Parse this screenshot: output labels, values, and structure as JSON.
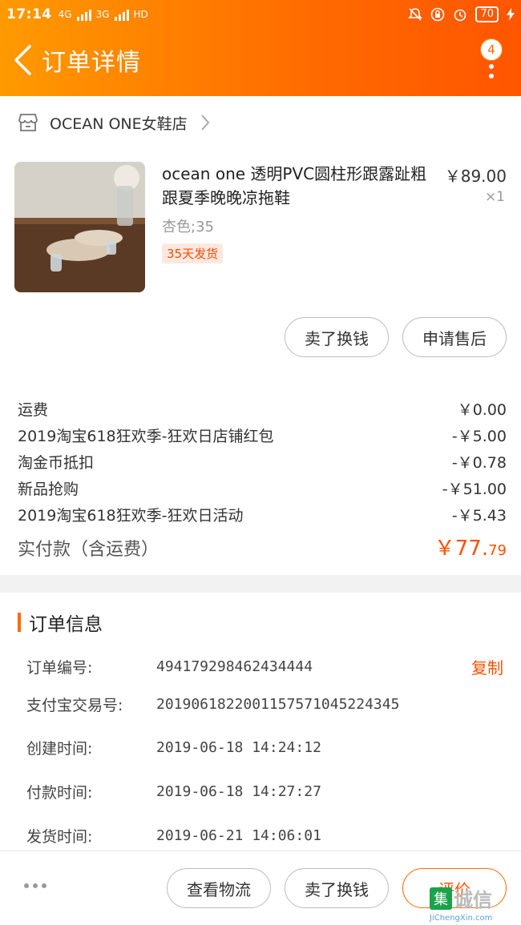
{
  "status_bar": {
    "time": "17:14",
    "net1": "4G",
    "net2": "3G",
    "net3": "HD",
    "battery": "70"
  },
  "nav": {
    "title": "订单详情",
    "badge_count": "4"
  },
  "shop": {
    "name": "OCEAN ONE女鞋店"
  },
  "product": {
    "title": "ocean one 透明PVC圆柱形跟露趾粗跟夏季晚晚凉拖鞋",
    "price": "￥89.00",
    "qty": "×1",
    "sku": "杏色;35",
    "ship_tag": "35天发货"
  },
  "item_actions": {
    "sell_label": "卖了换钱",
    "aftersale_label": "申请售后"
  },
  "fees": [
    {
      "label": "运费",
      "value": "￥0.00"
    },
    {
      "label": "2019淘宝618狂欢季-狂欢日店铺红包",
      "value": "-￥5.00"
    },
    {
      "label": "淘金币抵扣",
      "value": "-￥0.78"
    },
    {
      "label": "新品抢购",
      "value": "-￥51.00"
    },
    {
      "label": "2019淘宝618狂欢季-狂欢日活动",
      "value": "-￥5.43"
    }
  ],
  "paid": {
    "label": "实付款（含运费）",
    "currency": "￥",
    "amount_int": "77.",
    "amount_dec": "79"
  },
  "order_info": {
    "title": "订单信息",
    "copy_label": "复制",
    "rows": [
      {
        "key": "订单编号:",
        "value": "494179298462434444"
      },
      {
        "key": "支付宝交易号:",
        "value": "2019061822001157571045224345"
      },
      {
        "key": "创建时间:",
        "value": "2019-06-18 14:24:12"
      },
      {
        "key": "付款时间:",
        "value": "2019-06-18 14:27:27"
      },
      {
        "key": "发货时间:",
        "value": "2019-06-21 14:06:01"
      }
    ]
  },
  "footer": {
    "logistics_label": "查看物流",
    "sell_label": "卖了换钱",
    "review_label": "评价"
  },
  "watermark": {
    "char": "集",
    "text": "诚信",
    "url": "JiChengXin.com"
  },
  "colors": {
    "accent": "#ff5000",
    "header_start": "#ff9a00",
    "header_end": "#ff5500"
  }
}
